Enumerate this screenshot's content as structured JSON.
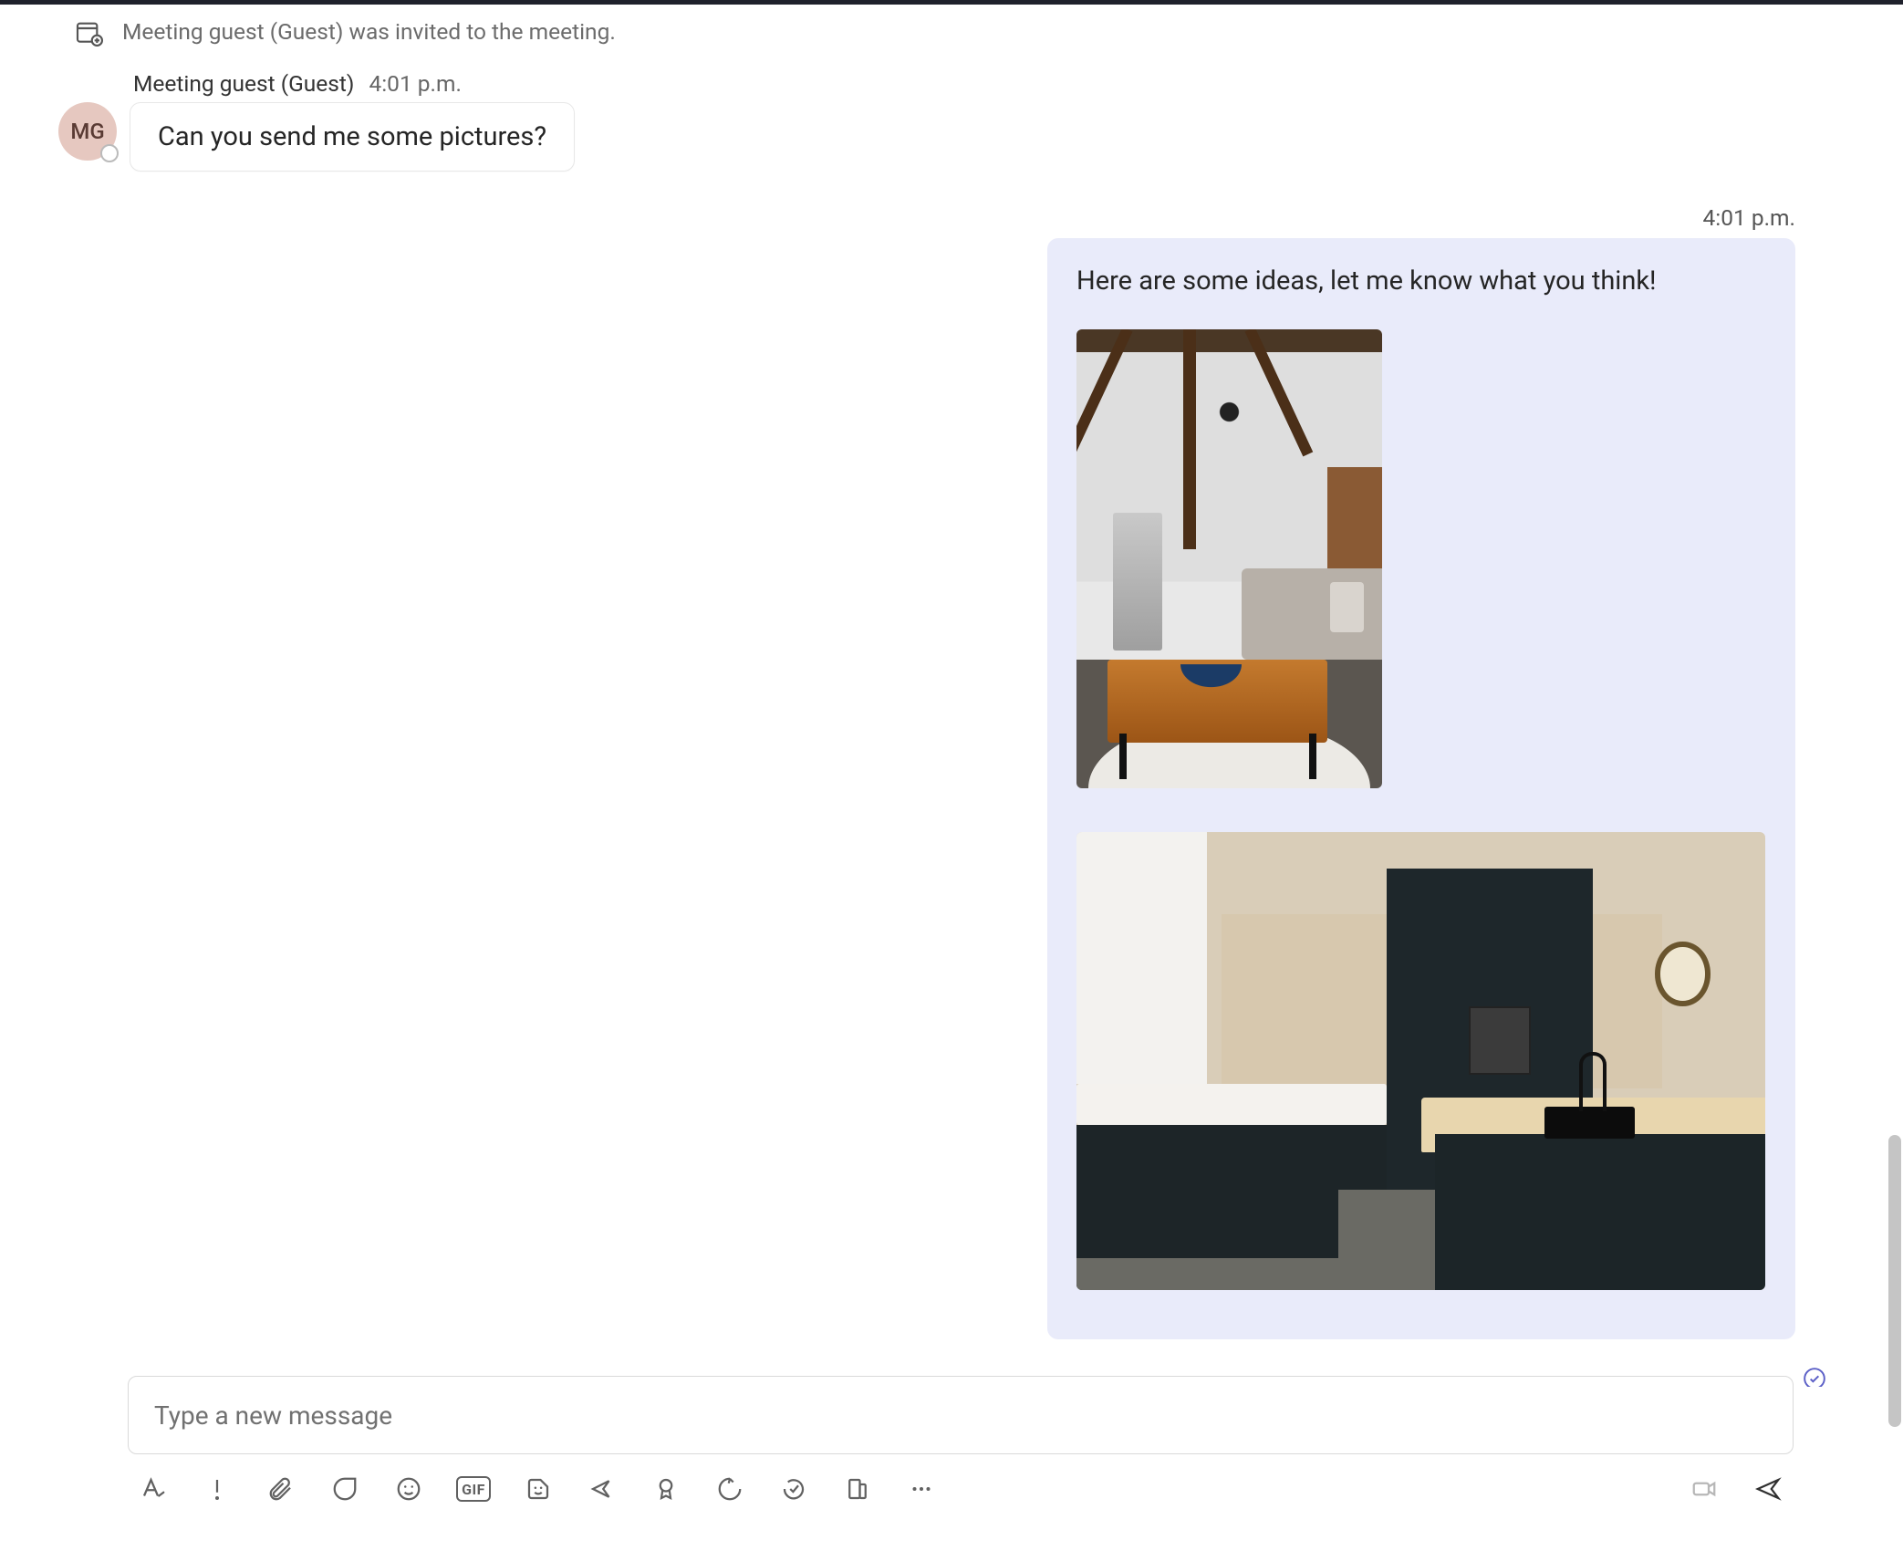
{
  "system_event": {
    "text": "Meeting guest (Guest) was invited to the meeting."
  },
  "incoming": {
    "avatar_initials": "MG",
    "sender": "Meeting guest (Guest)",
    "time": "4:01 p.m.",
    "message": "Can you send me some pictures?"
  },
  "outgoing": {
    "time": "4:01 p.m.",
    "message": "Here are some ideas, let me know what you think!",
    "attachments": [
      {
        "alt": "living-room-interior-photo"
      },
      {
        "alt": "modern-kitchen-photo"
      }
    ]
  },
  "composer": {
    "placeholder": "Type a new message"
  },
  "toolbar": {
    "gif_label": "GIF"
  }
}
